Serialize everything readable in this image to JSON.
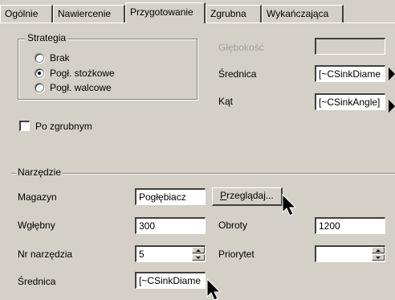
{
  "tabs": [
    {
      "label": "Ogólnie",
      "active": false
    },
    {
      "label": "Nawiercenie",
      "active": false
    },
    {
      "label": "Przygotowanie",
      "active": true
    },
    {
      "label": "Zgrubna",
      "active": false
    },
    {
      "label": "Wykańczająca",
      "active": false
    }
  ],
  "strategy": {
    "title": "Strategia",
    "options": [
      {
        "label": "Brak",
        "checked": false
      },
      {
        "label": "Pogł. stożkowe",
        "checked": true
      },
      {
        "label": "Pogł. walcowe",
        "checked": false
      }
    ]
  },
  "depth": {
    "label": "Głębokość",
    "value": "",
    "enabled": false
  },
  "diameter": {
    "label": "Średnica",
    "value": "[~CSinkDiame"
  },
  "angle": {
    "label": "Kąt",
    "value": "[~CSinkAngle]"
  },
  "after_roughing": {
    "label": "Po zgrubnym",
    "checked": false
  },
  "tool": {
    "title": "Narzędzie",
    "magazine": {
      "label": "Magazyn",
      "value": "Pogłębiacz"
    },
    "browse_button": {
      "label": "Przeglądaj...",
      "underline": "P",
      "rest": "rzeglądaj..."
    },
    "infeed": {
      "label": "Wgłębny",
      "value": "300"
    },
    "speed": {
      "label": "Obroty",
      "value": "1200"
    },
    "tool_number": {
      "label": "Nr narzędzia",
      "value": "5"
    },
    "priority": {
      "label": "Priorytet",
      "value": ""
    },
    "tool_diameter": {
      "label": "Średnica",
      "value": "[~CSinkDiame"
    }
  },
  "colors": {
    "face": "#d4d0c8",
    "highlight": "#ffffff",
    "shadow": "#808080",
    "dark_shadow": "#404040",
    "disabled_text": "#a0a0a0"
  },
  "icons": [
    "mouse-cursor-icon",
    "spin-up-icon",
    "spin-down-icon",
    "triangle-right-icon"
  ]
}
